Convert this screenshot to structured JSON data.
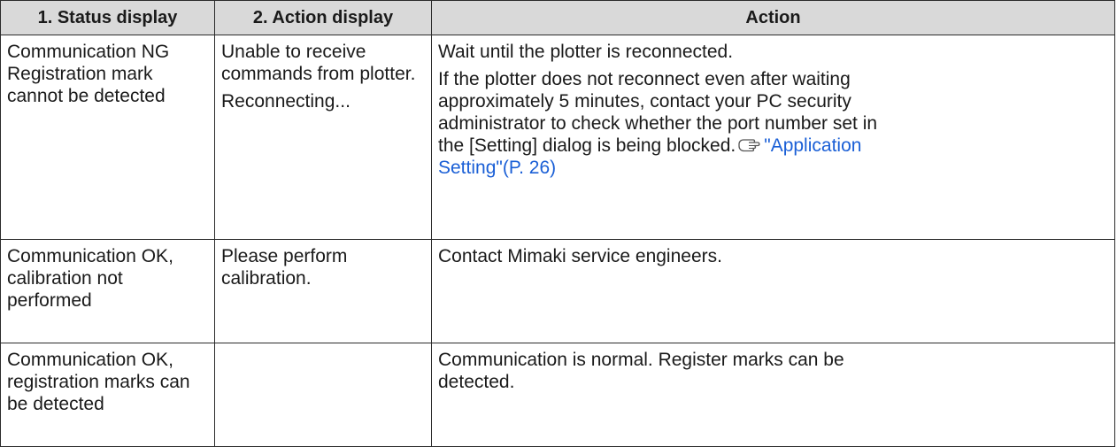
{
  "table": {
    "headers": [
      "1. Status display",
      "2. Action display",
      "Action"
    ],
    "rows": [
      {
        "status": [
          "Communication NG",
          "Registration mark",
          "cannot be detected"
        ],
        "action_display": [
          "Unable to receive",
          "commands from plotter."
        ],
        "action_display_2": "Reconnecting...",
        "action": {
          "p1": "Wait until the plotter is reconnected.",
          "p2_lines": [
            "If the plotter does not reconnect even after waiting",
            "approximately 5 minutes, contact your PC security",
            "administrator to check whether the port number set in"
          ],
          "p2_last": "the [Setting] dialog is being blocked.",
          "ref_icon": "pointing-hand-reference-icon",
          "ref_link_1": "\"Application",
          "ref_link_2": "Setting\"(P. 26)"
        }
      },
      {
        "status": [
          "Communication OK,",
          "calibration not",
          "performed"
        ],
        "action_display": [
          "Please perform",
          "calibration."
        ],
        "action": "Contact Mimaki service engineers."
      },
      {
        "status": [
          "Communication OK,",
          "registration marks can",
          "be detected"
        ],
        "action_display": [],
        "action": [
          "Communication is normal. Register marks can be",
          "detected."
        ]
      }
    ]
  },
  "colors": {
    "header_bg": "#d9d9d9",
    "border": "#2b2b2b",
    "link": "#1a5fd6"
  }
}
